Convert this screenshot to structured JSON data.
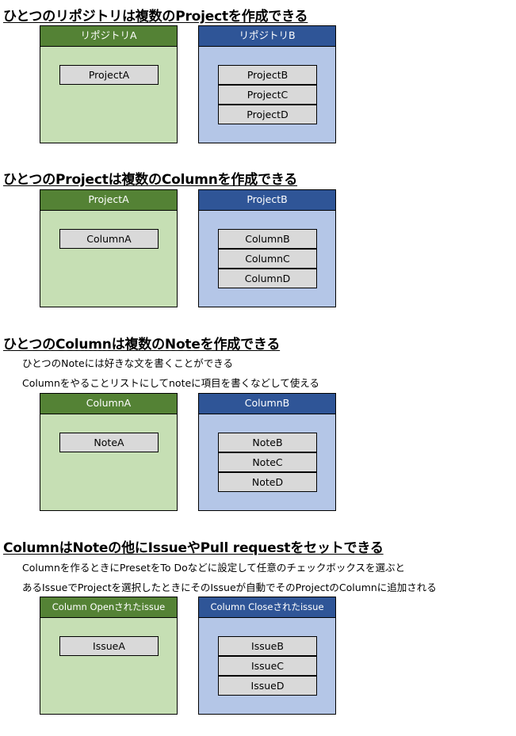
{
  "sections": [
    {
      "title": "ひとつのリポジトリは複数のProjectを作成できる",
      "notes": [],
      "left": {
        "header": "リポジトリA",
        "items": [
          "ProjectA"
        ]
      },
      "right": {
        "header": "リポジトリB",
        "items": [
          "ProjectB",
          "ProjectC",
          "ProjectD"
        ]
      }
    },
    {
      "title": "ひとつのProjectは複数のColumnを作成できる",
      "notes": [],
      "left": {
        "header": "ProjectA",
        "items": [
          "ColumnA"
        ]
      },
      "right": {
        "header": "ProjectB",
        "items": [
          "ColumnB",
          "ColumnC",
          "ColumnD"
        ]
      }
    },
    {
      "title": "ひとつのColumnは複数のNoteを作成できる",
      "notes": [
        "ひとつのNoteには好きな文を書くことができる",
        "Columnをやることリストにしてnoteに項目を書くなどして使える"
      ],
      "left": {
        "header": "ColumnA",
        "items": [
          "NoteA"
        ]
      },
      "right": {
        "header": "ColumnB",
        "items": [
          "NoteB",
          "NoteC",
          "NoteD"
        ]
      }
    },
    {
      "title": "ColumnはNoteの他にIssueやPull requestをセットできる",
      "notes": [
        "Columnを作るときにPresetをTo Doなどに設定して任意のチェックボックスを選ぶと",
        "あるIssueでProjectを選択したときにそのIssueが自動でそのProjectのColumnに追加される"
      ],
      "left": {
        "header": "Column Openされたissue",
        "items": [
          "IssueA"
        ]
      },
      "right": {
        "header": "Column Closeされたissue",
        "items": [
          "IssueB",
          "IssueC",
          "IssueD"
        ]
      }
    }
  ],
  "colors": {
    "green_header": "#548235",
    "green_body": "#c6dfb4",
    "blue_header": "#2f5597",
    "blue_body": "#b4c6e7",
    "item_bg": "#d9d9d9"
  }
}
